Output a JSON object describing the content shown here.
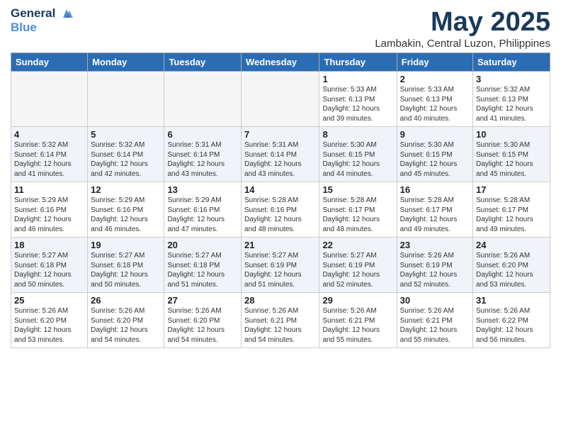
{
  "header": {
    "logo_line1": "General",
    "logo_line2": "Blue",
    "month": "May 2025",
    "location": "Lambakin, Central Luzon, Philippines"
  },
  "weekdays": [
    "Sunday",
    "Monday",
    "Tuesday",
    "Wednesday",
    "Thursday",
    "Friday",
    "Saturday"
  ],
  "weeks": [
    [
      {
        "day": "",
        "text": "",
        "empty": true
      },
      {
        "day": "",
        "text": "",
        "empty": true
      },
      {
        "day": "",
        "text": "",
        "empty": true
      },
      {
        "day": "",
        "text": "",
        "empty": true
      },
      {
        "day": "1",
        "text": "Sunrise: 5:33 AM\nSunset: 6:13 PM\nDaylight: 12 hours\nand 39 minutes.",
        "empty": false
      },
      {
        "day": "2",
        "text": "Sunrise: 5:33 AM\nSunset: 6:13 PM\nDaylight: 12 hours\nand 40 minutes.",
        "empty": false
      },
      {
        "day": "3",
        "text": "Sunrise: 5:32 AM\nSunset: 6:13 PM\nDaylight: 12 hours\nand 41 minutes.",
        "empty": false
      }
    ],
    [
      {
        "day": "4",
        "text": "Sunrise: 5:32 AM\nSunset: 6:14 PM\nDaylight: 12 hours\nand 41 minutes.",
        "empty": false
      },
      {
        "day": "5",
        "text": "Sunrise: 5:32 AM\nSunset: 6:14 PM\nDaylight: 12 hours\nand 42 minutes.",
        "empty": false
      },
      {
        "day": "6",
        "text": "Sunrise: 5:31 AM\nSunset: 6:14 PM\nDaylight: 12 hours\nand 43 minutes.",
        "empty": false
      },
      {
        "day": "7",
        "text": "Sunrise: 5:31 AM\nSunset: 6:14 PM\nDaylight: 12 hours\nand 43 minutes.",
        "empty": false
      },
      {
        "day": "8",
        "text": "Sunrise: 5:30 AM\nSunset: 6:15 PM\nDaylight: 12 hours\nand 44 minutes.",
        "empty": false
      },
      {
        "day": "9",
        "text": "Sunrise: 5:30 AM\nSunset: 6:15 PM\nDaylight: 12 hours\nand 45 minutes.",
        "empty": false
      },
      {
        "day": "10",
        "text": "Sunrise: 5:30 AM\nSunset: 6:15 PM\nDaylight: 12 hours\nand 45 minutes.",
        "empty": false
      }
    ],
    [
      {
        "day": "11",
        "text": "Sunrise: 5:29 AM\nSunset: 6:16 PM\nDaylight: 12 hours\nand 46 minutes.",
        "empty": false
      },
      {
        "day": "12",
        "text": "Sunrise: 5:29 AM\nSunset: 6:16 PM\nDaylight: 12 hours\nand 46 minutes.",
        "empty": false
      },
      {
        "day": "13",
        "text": "Sunrise: 5:29 AM\nSunset: 6:16 PM\nDaylight: 12 hours\nand 47 minutes.",
        "empty": false
      },
      {
        "day": "14",
        "text": "Sunrise: 5:28 AM\nSunset: 6:16 PM\nDaylight: 12 hours\nand 48 minutes.",
        "empty": false
      },
      {
        "day": "15",
        "text": "Sunrise: 5:28 AM\nSunset: 6:17 PM\nDaylight: 12 hours\nand 48 minutes.",
        "empty": false
      },
      {
        "day": "16",
        "text": "Sunrise: 5:28 AM\nSunset: 6:17 PM\nDaylight: 12 hours\nand 49 minutes.",
        "empty": false
      },
      {
        "day": "17",
        "text": "Sunrise: 5:28 AM\nSunset: 6:17 PM\nDaylight: 12 hours\nand 49 minutes.",
        "empty": false
      }
    ],
    [
      {
        "day": "18",
        "text": "Sunrise: 5:27 AM\nSunset: 6:18 PM\nDaylight: 12 hours\nand 50 minutes.",
        "empty": false
      },
      {
        "day": "19",
        "text": "Sunrise: 5:27 AM\nSunset: 6:18 PM\nDaylight: 12 hours\nand 50 minutes.",
        "empty": false
      },
      {
        "day": "20",
        "text": "Sunrise: 5:27 AM\nSunset: 6:18 PM\nDaylight: 12 hours\nand 51 minutes.",
        "empty": false
      },
      {
        "day": "21",
        "text": "Sunrise: 5:27 AM\nSunset: 6:19 PM\nDaylight: 12 hours\nand 51 minutes.",
        "empty": false
      },
      {
        "day": "22",
        "text": "Sunrise: 5:27 AM\nSunset: 6:19 PM\nDaylight: 12 hours\nand 52 minutes.",
        "empty": false
      },
      {
        "day": "23",
        "text": "Sunrise: 5:26 AM\nSunset: 6:19 PM\nDaylight: 12 hours\nand 52 minutes.",
        "empty": false
      },
      {
        "day": "24",
        "text": "Sunrise: 5:26 AM\nSunset: 6:20 PM\nDaylight: 12 hours\nand 53 minutes.",
        "empty": false
      }
    ],
    [
      {
        "day": "25",
        "text": "Sunrise: 5:26 AM\nSunset: 6:20 PM\nDaylight: 12 hours\nand 53 minutes.",
        "empty": false
      },
      {
        "day": "26",
        "text": "Sunrise: 5:26 AM\nSunset: 6:20 PM\nDaylight: 12 hours\nand 54 minutes.",
        "empty": false
      },
      {
        "day": "27",
        "text": "Sunrise: 5:26 AM\nSunset: 6:20 PM\nDaylight: 12 hours\nand 54 minutes.",
        "empty": false
      },
      {
        "day": "28",
        "text": "Sunrise: 5:26 AM\nSunset: 6:21 PM\nDaylight: 12 hours\nand 54 minutes.",
        "empty": false
      },
      {
        "day": "29",
        "text": "Sunrise: 5:26 AM\nSunset: 6:21 PM\nDaylight: 12 hours\nand 55 minutes.",
        "empty": false
      },
      {
        "day": "30",
        "text": "Sunrise: 5:26 AM\nSunset: 6:21 PM\nDaylight: 12 hours\nand 55 minutes.",
        "empty": false
      },
      {
        "day": "31",
        "text": "Sunrise: 5:26 AM\nSunset: 6:22 PM\nDaylight: 12 hours\nand 56 minutes.",
        "empty": false
      }
    ]
  ]
}
